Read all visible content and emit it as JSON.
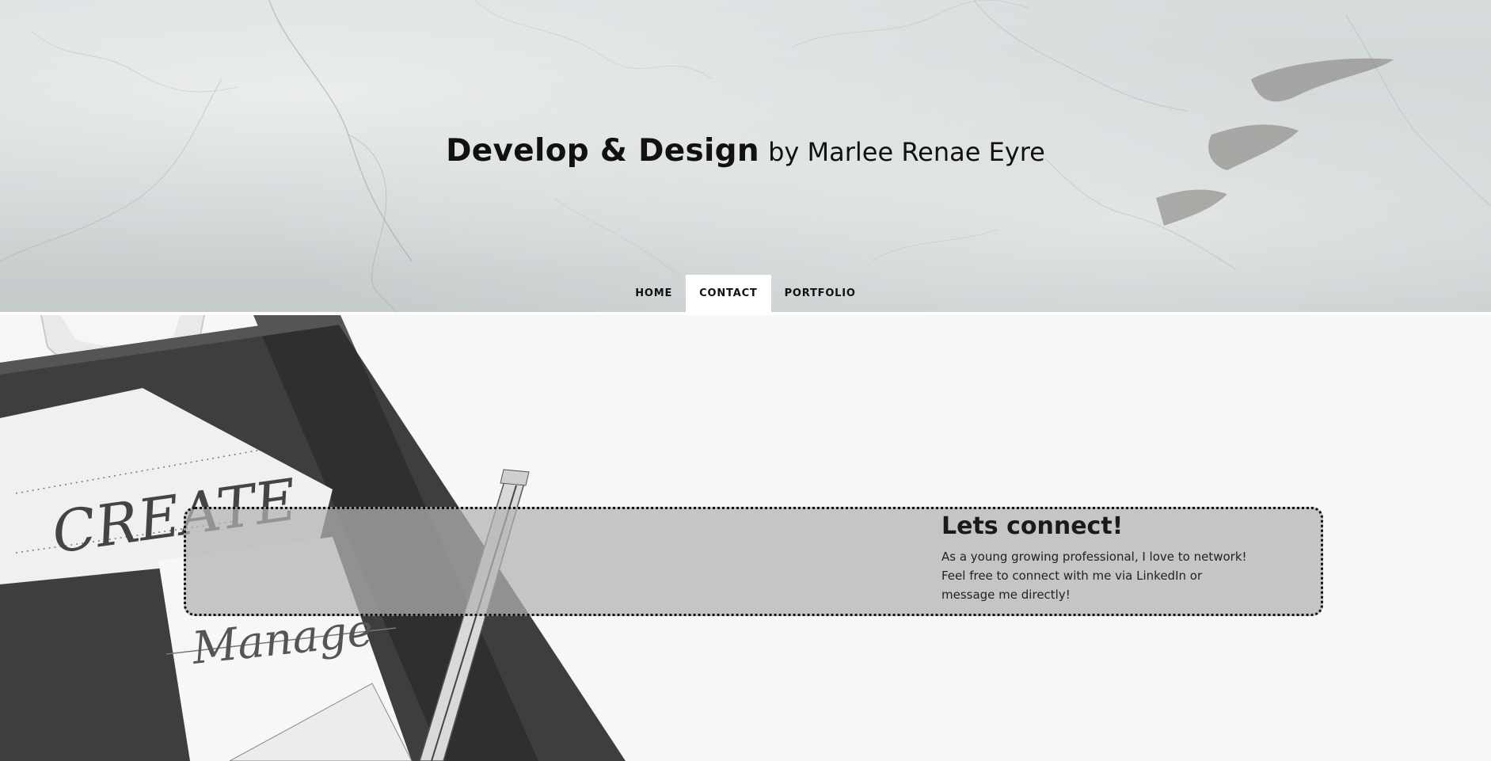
{
  "header": {
    "title_main": "Develop & Design",
    "title_sub": "by Marlee Renae Eyre"
  },
  "nav": {
    "items": [
      {
        "label": "HOME",
        "active": false
      },
      {
        "label": "CONTACT",
        "active": true
      },
      {
        "label": "PORTFOLIO",
        "active": false
      }
    ]
  },
  "contact": {
    "heading": "Lets connect!",
    "body": "As a young growing professional, I love to network! Feel free to connect with me via LinkedIn or message me directly!"
  },
  "photo_notes": {
    "word_1": "CREATE",
    "word_2": "Manage"
  },
  "colors": {
    "active_tab_bg": "#ffffff",
    "card_bg": "#b2b2b2",
    "card_border": "#111111"
  }
}
